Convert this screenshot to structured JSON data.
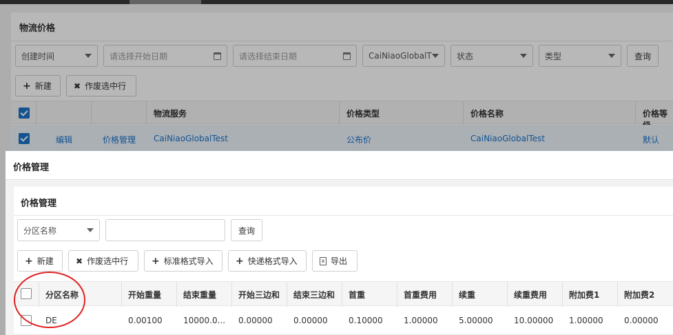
{
  "background": {
    "title": "物流价格",
    "filters": {
      "created_time": "创建时间",
      "start_date_placeholder": "请选择开始日期",
      "end_date_placeholder": "请选择结束日期",
      "service": "CaiNiaoGlobalT",
      "status": "状态",
      "type": "类型",
      "search_label": "查询"
    },
    "toolbar": {
      "new_label": "新建",
      "void_label": "作废选中行"
    },
    "table": {
      "headers": [
        "物流服务",
        "价格类型",
        "价格名称",
        "价格等级"
      ],
      "row": {
        "edit": "编辑",
        "price_manage": "价格管理",
        "service": "CaiNiaoGlobalTest",
        "price_type": "公布价",
        "price_name": "CaiNiaoGlobalTest",
        "level": "默认"
      }
    }
  },
  "modal": {
    "title": "价格管理",
    "inner_title": "价格管理",
    "filter": {
      "zone_select": "分区名称",
      "search_value": "",
      "search_label": "查询"
    },
    "toolbar": {
      "new_label": "新建",
      "void_label": "作废选中行",
      "std_import_label": "标准格式导入",
      "express_import_label": "快递格式导入",
      "export_label": "导出"
    },
    "table": {
      "headers": [
        "分区名称",
        "开始重量",
        "结束重量",
        "开始三边和",
        "结束三边和",
        "首重",
        "首重费用",
        "续重",
        "续重费用",
        "附加费1",
        "附加费2"
      ],
      "rows": [
        [
          "DE",
          "0.00100",
          "10000.0...",
          "0.00000",
          "0.00000",
          "0.10000",
          "1.00000",
          "5.00000",
          "10.00000",
          "1.00000",
          "0.00000"
        ]
      ]
    }
  },
  "colors": {
    "accent": "#1a73c8",
    "annotation": "#e02020"
  }
}
